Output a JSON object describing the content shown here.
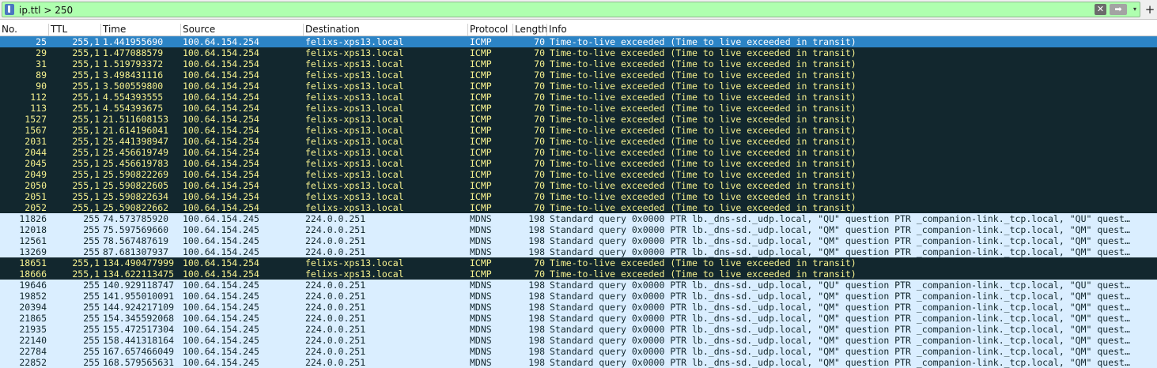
{
  "filter": {
    "expression": "ip.ttl > 250",
    "clear_glyph": "✕",
    "apply_glyph": "➡",
    "dropdown_glyph": "▾",
    "add_glyph": "+"
  },
  "colors": {
    "filter_valid_bg": "#afffaf",
    "icmp_row_bg": "#12272e",
    "icmp_row_fg": "#f7f28f",
    "mdns_row_bg": "#daeeff",
    "selected_row_bg": "#2c84c6"
  },
  "columns": [
    "No.",
    "TTL",
    "Time",
    "Source",
    "Destination",
    "Protocol",
    "Length",
    "Info"
  ],
  "rows": [
    {
      "type": "sel",
      "no": "25",
      "ttl": "255,1",
      "time": "1.441955690",
      "src": "100.64.154.254",
      "dst": "felixs-xps13.local",
      "proto": "ICMP",
      "len": "70",
      "info": "Time-to-live exceeded (Time to live exceeded in transit)"
    },
    {
      "type": "icmp",
      "no": "29",
      "ttl": "255,1",
      "time": "1.477088579",
      "src": "100.64.154.254",
      "dst": "felixs-xps13.local",
      "proto": "ICMP",
      "len": "70",
      "info": "Time-to-live exceeded (Time to live exceeded in transit)"
    },
    {
      "type": "icmp",
      "no": "31",
      "ttl": "255,1",
      "time": "1.519793372",
      "src": "100.64.154.254",
      "dst": "felixs-xps13.local",
      "proto": "ICMP",
      "len": "70",
      "info": "Time-to-live exceeded (Time to live exceeded in transit)"
    },
    {
      "type": "icmp",
      "no": "89",
      "ttl": "255,1",
      "time": "3.498431116",
      "src": "100.64.154.254",
      "dst": "felixs-xps13.local",
      "proto": "ICMP",
      "len": "70",
      "info": "Time-to-live exceeded (Time to live exceeded in transit)"
    },
    {
      "type": "icmp",
      "no": "90",
      "ttl": "255,1",
      "time": "3.500559800",
      "src": "100.64.154.254",
      "dst": "felixs-xps13.local",
      "proto": "ICMP",
      "len": "70",
      "info": "Time-to-live exceeded (Time to live exceeded in transit)"
    },
    {
      "type": "icmp",
      "no": "112",
      "ttl": "255,1",
      "time": "4.554393555",
      "src": "100.64.154.254",
      "dst": "felixs-xps13.local",
      "proto": "ICMP",
      "len": "70",
      "info": "Time-to-live exceeded (Time to live exceeded in transit)"
    },
    {
      "type": "icmp",
      "no": "113",
      "ttl": "255,1",
      "time": "4.554393675",
      "src": "100.64.154.254",
      "dst": "felixs-xps13.local",
      "proto": "ICMP",
      "len": "70",
      "info": "Time-to-live exceeded (Time to live exceeded in transit)"
    },
    {
      "type": "icmp",
      "no": "1527",
      "ttl": "255,1",
      "time": "21.511608153",
      "src": "100.64.154.254",
      "dst": "felixs-xps13.local",
      "proto": "ICMP",
      "len": "70",
      "info": "Time-to-live exceeded (Time to live exceeded in transit)"
    },
    {
      "type": "icmp",
      "no": "1567",
      "ttl": "255,1",
      "time": "21.614196041",
      "src": "100.64.154.254",
      "dst": "felixs-xps13.local",
      "proto": "ICMP",
      "len": "70",
      "info": "Time-to-live exceeded (Time to live exceeded in transit)"
    },
    {
      "type": "icmp",
      "no": "2031",
      "ttl": "255,1",
      "time": "25.441398947",
      "src": "100.64.154.254",
      "dst": "felixs-xps13.local",
      "proto": "ICMP",
      "len": "70",
      "info": "Time-to-live exceeded (Time to live exceeded in transit)"
    },
    {
      "type": "icmp",
      "no": "2044",
      "ttl": "255,1",
      "time": "25.456619749",
      "src": "100.64.154.254",
      "dst": "felixs-xps13.local",
      "proto": "ICMP",
      "len": "70",
      "info": "Time-to-live exceeded (Time to live exceeded in transit)"
    },
    {
      "type": "icmp",
      "no": "2045",
      "ttl": "255,1",
      "time": "25.456619783",
      "src": "100.64.154.254",
      "dst": "felixs-xps13.local",
      "proto": "ICMP",
      "len": "70",
      "info": "Time-to-live exceeded (Time to live exceeded in transit)"
    },
    {
      "type": "icmp",
      "no": "2049",
      "ttl": "255,1",
      "time": "25.590822269",
      "src": "100.64.154.254",
      "dst": "felixs-xps13.local",
      "proto": "ICMP",
      "len": "70",
      "info": "Time-to-live exceeded (Time to live exceeded in transit)"
    },
    {
      "type": "icmp",
      "no": "2050",
      "ttl": "255,1",
      "time": "25.590822605",
      "src": "100.64.154.254",
      "dst": "felixs-xps13.local",
      "proto": "ICMP",
      "len": "70",
      "info": "Time-to-live exceeded (Time to live exceeded in transit)"
    },
    {
      "type": "icmp",
      "no": "2051",
      "ttl": "255,1",
      "time": "25.590822634",
      "src": "100.64.154.254",
      "dst": "felixs-xps13.local",
      "proto": "ICMP",
      "len": "70",
      "info": "Time-to-live exceeded (Time to live exceeded in transit)"
    },
    {
      "type": "icmp",
      "no": "2052",
      "ttl": "255,1",
      "time": "25.590822662",
      "src": "100.64.154.254",
      "dst": "felixs-xps13.local",
      "proto": "ICMP",
      "len": "70",
      "info": "Time-to-live exceeded (Time to live exceeded in transit)"
    },
    {
      "type": "mdns",
      "no": "11826",
      "ttl": "255",
      "time": "74.573785920",
      "src": "100.64.154.245",
      "dst": "224.0.0.251",
      "proto": "MDNS",
      "len": "198",
      "info": "Standard query 0x0000 PTR lb._dns-sd._udp.local, \"QU\" question PTR _companion-link._tcp.local, \"QU\" quest…"
    },
    {
      "type": "mdns",
      "no": "12018",
      "ttl": "255",
      "time": "75.597569660",
      "src": "100.64.154.245",
      "dst": "224.0.0.251",
      "proto": "MDNS",
      "len": "198",
      "info": "Standard query 0x0000 PTR lb._dns-sd._udp.local, \"QM\" question PTR _companion-link._tcp.local, \"QM\" quest…"
    },
    {
      "type": "mdns",
      "no": "12561",
      "ttl": "255",
      "time": "78.567487619",
      "src": "100.64.154.245",
      "dst": "224.0.0.251",
      "proto": "MDNS",
      "len": "198",
      "info": "Standard query 0x0000 PTR lb._dns-sd._udp.local, \"QM\" question PTR _companion-link._tcp.local, \"QM\" quest…"
    },
    {
      "type": "mdns",
      "no": "13269",
      "ttl": "255",
      "time": "87.681307937",
      "src": "100.64.154.245",
      "dst": "224.0.0.251",
      "proto": "MDNS",
      "len": "198",
      "info": "Standard query 0x0000 PTR lb._dns-sd._udp.local, \"QM\" question PTR _companion-link._tcp.local, \"QM\" quest…"
    },
    {
      "type": "icmp",
      "no": "18651",
      "ttl": "255,1",
      "time": "134.490477999",
      "src": "100.64.154.254",
      "dst": "felixs-xps13.local",
      "proto": "ICMP",
      "len": "70",
      "info": "Time-to-live exceeded (Time to live exceeded in transit)"
    },
    {
      "type": "icmp",
      "no": "18666",
      "ttl": "255,1",
      "time": "134.622113475",
      "src": "100.64.154.254",
      "dst": "felixs-xps13.local",
      "proto": "ICMP",
      "len": "70",
      "info": "Time-to-live exceeded (Time to live exceeded in transit)"
    },
    {
      "type": "mdns",
      "no": "19646",
      "ttl": "255",
      "time": "140.929118747",
      "src": "100.64.154.245",
      "dst": "224.0.0.251",
      "proto": "MDNS",
      "len": "198",
      "info": "Standard query 0x0000 PTR lb._dns-sd._udp.local, \"QU\" question PTR _companion-link._tcp.local, \"QU\" quest…"
    },
    {
      "type": "mdns",
      "no": "19852",
      "ttl": "255",
      "time": "141.955010091",
      "src": "100.64.154.245",
      "dst": "224.0.0.251",
      "proto": "MDNS",
      "len": "198",
      "info": "Standard query 0x0000 PTR lb._dns-sd._udp.local, \"QM\" question PTR _companion-link._tcp.local, \"QM\" quest…"
    },
    {
      "type": "mdns",
      "no": "20394",
      "ttl": "255",
      "time": "144.924217109",
      "src": "100.64.154.245",
      "dst": "224.0.0.251",
      "proto": "MDNS",
      "len": "198",
      "info": "Standard query 0x0000 PTR lb._dns-sd._udp.local, \"QM\" question PTR _companion-link._tcp.local, \"QM\" quest…"
    },
    {
      "type": "mdns",
      "no": "21865",
      "ttl": "255",
      "time": "154.345592068",
      "src": "100.64.154.245",
      "dst": "224.0.0.251",
      "proto": "MDNS",
      "len": "198",
      "info": "Standard query 0x0000 PTR lb._dns-sd._udp.local, \"QM\" question PTR _companion-link._tcp.local, \"QM\" quest…"
    },
    {
      "type": "mdns",
      "no": "21935",
      "ttl": "255",
      "time": "155.472517304",
      "src": "100.64.154.245",
      "dst": "224.0.0.251",
      "proto": "MDNS",
      "len": "198",
      "info": "Standard query 0x0000 PTR lb._dns-sd._udp.local, \"QM\" question PTR _companion-link._tcp.local, \"QM\" quest…"
    },
    {
      "type": "mdns",
      "no": "22140",
      "ttl": "255",
      "time": "158.441318164",
      "src": "100.64.154.245",
      "dst": "224.0.0.251",
      "proto": "MDNS",
      "len": "198",
      "info": "Standard query 0x0000 PTR lb._dns-sd._udp.local, \"QM\" question PTR _companion-link._tcp.local, \"QM\" quest…"
    },
    {
      "type": "mdns",
      "no": "22784",
      "ttl": "255",
      "time": "167.657466049",
      "src": "100.64.154.245",
      "dst": "224.0.0.251",
      "proto": "MDNS",
      "len": "198",
      "info": "Standard query 0x0000 PTR lb._dns-sd._udp.local, \"QM\" question PTR _companion-link._tcp.local, \"QM\" quest…"
    },
    {
      "type": "mdns",
      "no": "22852",
      "ttl": "255",
      "time": "168.579565631",
      "src": "100.64.154.245",
      "dst": "224.0.0.251",
      "proto": "MDNS",
      "len": "198",
      "info": "Standard query 0x0000 PTR lb._dns-sd._udp.local, \"QM\" question PTR _companion-link._tcp.local, \"QM\" quest…"
    }
  ]
}
